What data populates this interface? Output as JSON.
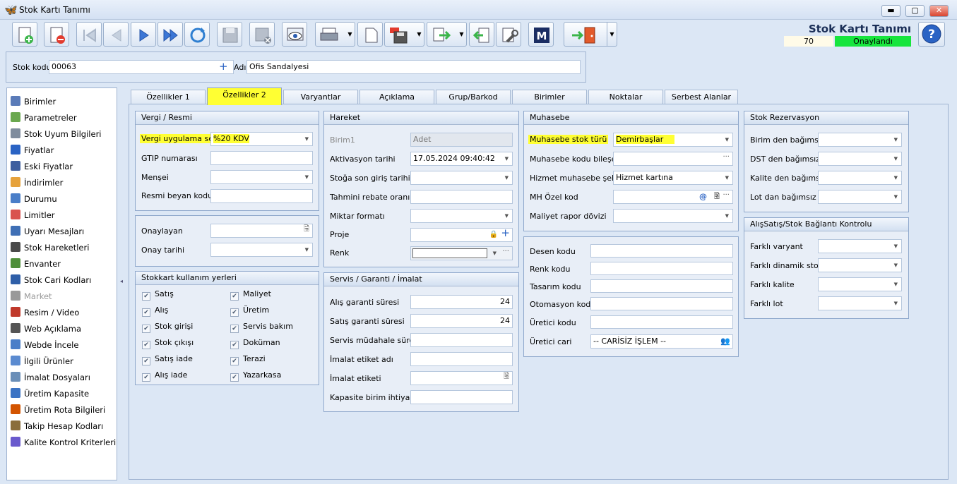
{
  "window": {
    "title": "Stok Kartı Tanımı",
    "minimize": "▬",
    "maximize": "▢",
    "close": "✕"
  },
  "header": {
    "title": "Stok Kartı Tanımı",
    "count": "70",
    "status": "Onaylandı",
    "help": "?"
  },
  "colors": {
    "highlight": "#ffff33",
    "status_green": "#17e53d",
    "title_blue": "#1a2e57"
  },
  "toolbar": [
    {
      "name": "new-record-icon"
    },
    {
      "name": "delete-record-icon"
    },
    {
      "name": "first-record-icon"
    },
    {
      "name": "previous-record-icon"
    },
    {
      "name": "next-record-icon"
    },
    {
      "name": "last-record-icon"
    },
    {
      "name": "refresh-icon"
    },
    {
      "name": "save-icon"
    },
    {
      "name": "save-cancel-icon"
    },
    {
      "name": "preview-icon"
    },
    {
      "name": "print-icon"
    },
    {
      "name": "copy-icon"
    },
    {
      "name": "pdf-save-icon"
    },
    {
      "name": "transfer-icon"
    },
    {
      "name": "back-icon"
    },
    {
      "name": "tools-icon"
    },
    {
      "name": "m-icon",
      "label": "M"
    },
    {
      "name": "exit-icon"
    }
  ],
  "stok": {
    "kod_label": "Stok kodu",
    "kod_value": "00063",
    "ad_label": "Adı",
    "ad_value": "Ofis Sandalyesi"
  },
  "sidebar": {
    "items": [
      {
        "label": "Birimler",
        "icon": "units-icon"
      },
      {
        "label": "Parametreler",
        "icon": "parameters-icon"
      },
      {
        "label": "Stok Uyum Bilgileri",
        "icon": "compat-icon"
      },
      {
        "label": "Fiyatlar",
        "icon": "price-icon"
      },
      {
        "label": "Eski Fiyatlar",
        "icon": "old-price-icon"
      },
      {
        "label": "İndirimler",
        "icon": "discount-icon"
      },
      {
        "label": "Durumu",
        "icon": "status-icon"
      },
      {
        "label": "Limitler",
        "icon": "limits-icon"
      },
      {
        "label": "Uyarı Mesajları",
        "icon": "warning-icon"
      },
      {
        "label": "Stok Hareketleri",
        "icon": "movements-icon"
      },
      {
        "label": "Envanter",
        "icon": "inventory-icon"
      },
      {
        "label": "Stok Cari Kodları",
        "icon": "account-codes-icon"
      },
      {
        "label": "Market",
        "icon": "market-icon"
      },
      {
        "label": "Resim / Video",
        "icon": "media-icon"
      },
      {
        "label": "Web Açıklama",
        "icon": "web-desc-icon"
      },
      {
        "label": "Webde İncele",
        "icon": "web-view-icon"
      },
      {
        "label": "İlgili Ürünler",
        "icon": "related-icon"
      },
      {
        "label": "İmalat Dosyaları",
        "icon": "production-files-icon"
      },
      {
        "label": "Üretim Kapasite",
        "icon": "capacity-icon"
      },
      {
        "label": "Üretim Rota Bilgileri",
        "icon": "route-icon"
      },
      {
        "label": "Takip Hesap Kodları",
        "icon": "tracking-icon"
      },
      {
        "label": "Kalite Kontrol Kriterleri",
        "icon": "quality-icon"
      }
    ]
  },
  "tabs": [
    "Özellikler 1",
    "Özellikler 2",
    "Varyantlar",
    "Açıklama",
    "Grup/Barkod",
    "Birimler",
    "Noktalar",
    "Serbest Alanlar"
  ],
  "vergi": {
    "title": "Vergi / Resmi",
    "uygulama_label": "Vergi uygulama seti",
    "uygulama_value": "%20 KDV",
    "gtip_label": "GTIP numarası",
    "mensei_label": "Menşei",
    "beyan_label": "Resmi beyan kodu"
  },
  "onay": {
    "onaylayan_label": "Onaylayan",
    "tarih_label": "Onay tarihi"
  },
  "kullanim": {
    "title": "Stokkart kullanım yerleri",
    "left": [
      "Satış",
      "Alış",
      "Stok girişi",
      "Stok çıkışı",
      "Satış iade",
      "Alış iade"
    ],
    "right": [
      "Maliyet",
      "Üretim",
      "Servis bakım",
      "Doküman",
      "Terazi",
      "Yazarkasa"
    ]
  },
  "hareket": {
    "title": "Hareket",
    "birim_label": "Birim1",
    "birim_value": "Adet",
    "aktivasyon_label": "Aktivasyon tarihi",
    "aktivasyon_value": "17.05.2024 09:40:42",
    "son_giris_label": "Stoğa son giriş tarihi",
    "rebate_label": "Tahmini rebate oranı",
    "miktar_label": "Miktar formatı",
    "proje_label": "Proje",
    "renk_label": "Renk"
  },
  "servis": {
    "title": "Servis / Garanti / İmalat",
    "alis_label": "Alış garanti süresi",
    "alis_value": "24",
    "satis_label": "Satış garanti süresi",
    "satis_value": "24",
    "mudahale_label": "Servis müdahale süresi",
    "etiket_adi_label": "İmalat etiket adı",
    "etiket_label": "İmalat etiketi",
    "kapasite_label": "Kapasite birim ihtiyaç"
  },
  "muhasebe": {
    "title": "Muhasebe",
    "stok_turu_label": "Muhasebe stok türü",
    "stok_turu_value": "Demirbaşlar",
    "bileseni_label": "Muhasebe kodu bileşeni",
    "hizmet_label": "Hizmet muhasebe şekli",
    "hizmet_value": "Hizmet kartına",
    "mh_label": "MH Özel kod",
    "maliyet_label": "Maliyet rapor dövizi"
  },
  "kodlar": {
    "desen_label": "Desen kodu",
    "renk_label": "Renk kodu",
    "tasarim_label": "Tasarım kodu",
    "otomasyon_label": "Otomasyon kodu",
    "uretici_label": "Üretici kodu",
    "uretici_cari_label": "Üretici cari",
    "uretici_cari_value": "-- CARİSİZ İŞLEM --"
  },
  "rezervasyon": {
    "title": "Stok Rezervasyon",
    "items": [
      "Birim den bağımsız",
      "DST den bağımsız",
      "Kalite den bağımsız",
      "Lot dan bağımsız"
    ]
  },
  "baglanti": {
    "title": "AlışSatış/Stok Bağlantı Kontrolu",
    "items": [
      "Farklı varyant",
      "Farklı dinamik stok",
      "Farklı kalite",
      "Farklı lot"
    ]
  }
}
